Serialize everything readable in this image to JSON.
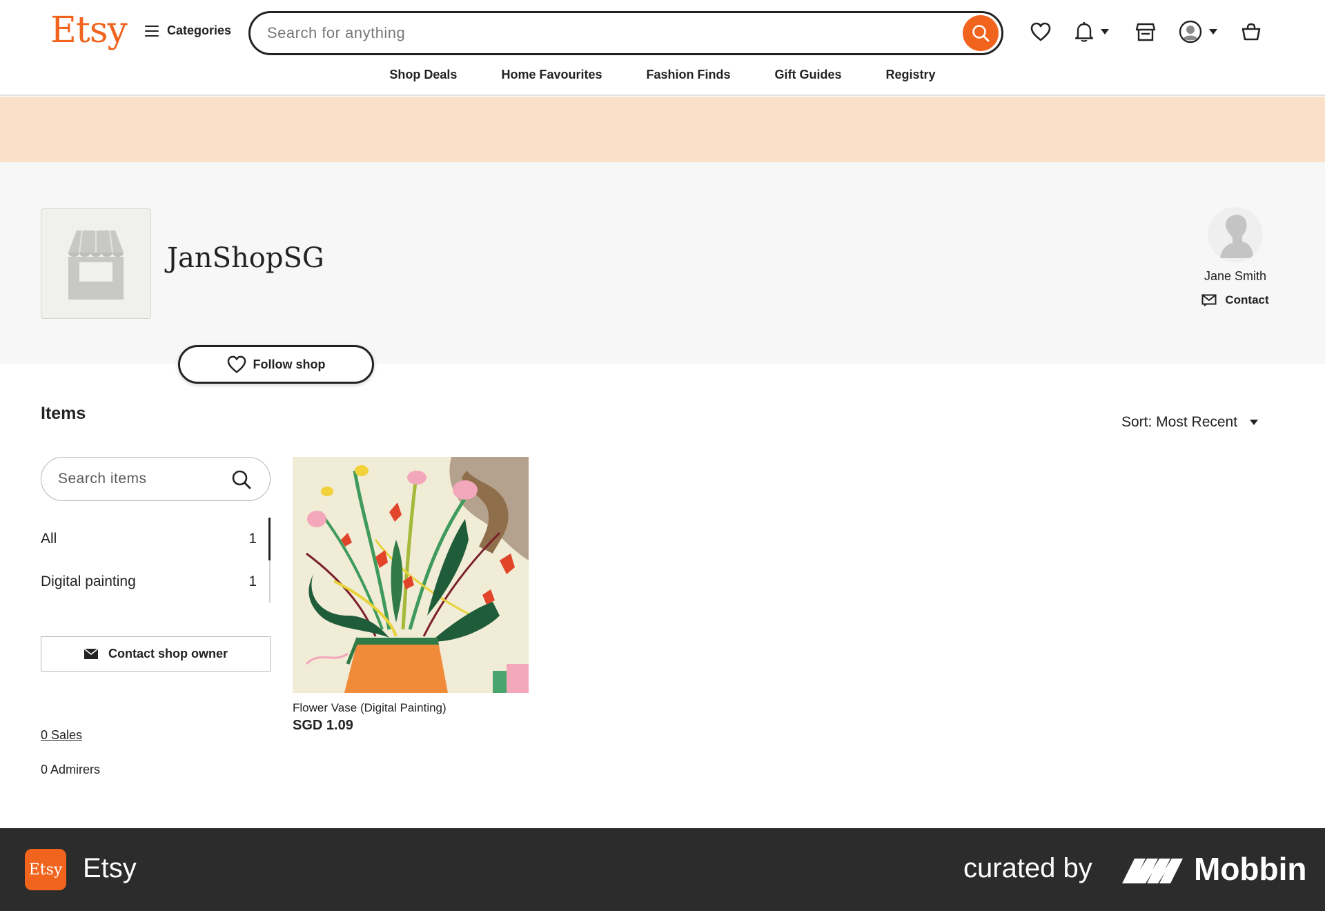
{
  "header": {
    "logo": "Etsy",
    "categories_label": "Categories",
    "search_placeholder": "Search for anything",
    "nav": [
      "Shop Deals",
      "Home Favourites",
      "Fashion Finds",
      "Gift Guides",
      "Registry"
    ],
    "icons": [
      "heart-icon",
      "bell-icon",
      "shop-icon",
      "account-icon",
      "cart-icon"
    ]
  },
  "shop": {
    "name": "JanShopSG",
    "follow_label": "Follow shop",
    "owner_name": "Jane Smith",
    "contact_label": "Contact"
  },
  "items": {
    "title": "Items",
    "sort_label": "Sort: Most Recent",
    "search_placeholder": "Search items",
    "categories": [
      {
        "label": "All",
        "count": "1"
      },
      {
        "label": "Digital painting",
        "count": "1"
      }
    ],
    "contact_owner_label": "Contact shop owner",
    "sales_label": "0 Sales",
    "admirers_label": "0 Admirers",
    "listings": [
      {
        "title": "Flower Vase (Digital Painting)",
        "price": "SGD 1.09"
      }
    ]
  },
  "footer": {
    "badge": "Etsy",
    "app_name": "Etsy",
    "curated_by": "curated by",
    "brand": "Mobbin"
  },
  "colors": {
    "accent": "#f1641e",
    "banner": "#fae0c8",
    "shop_bg": "#f7f7f7",
    "footer_bg": "#2c2c2c"
  }
}
